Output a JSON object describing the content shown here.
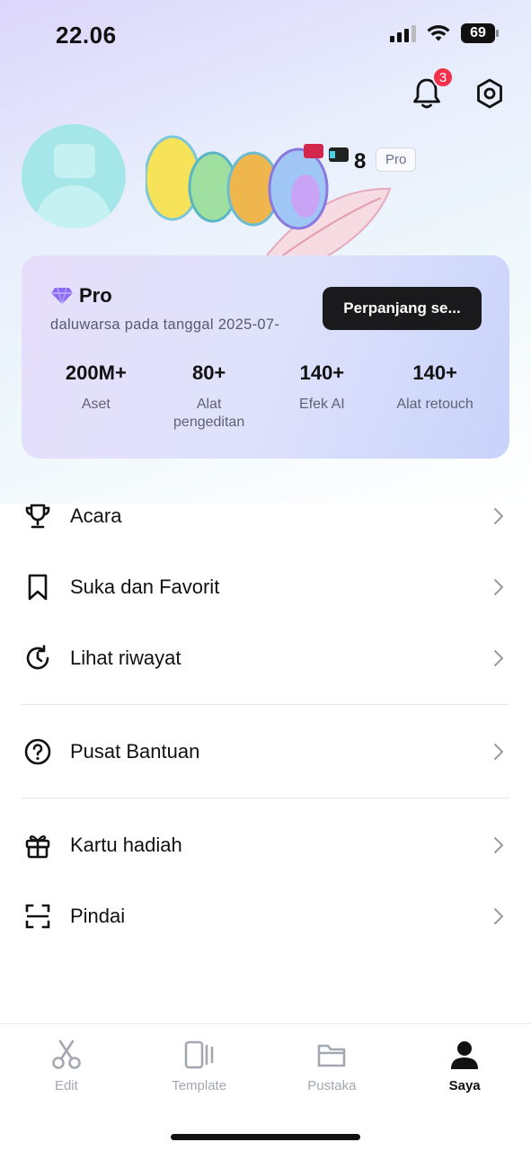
{
  "status_bar": {
    "time": "22.06",
    "battery": "69"
  },
  "header": {
    "notification_count": "3",
    "icons": [
      "bell-icon",
      "settings-hex-icon"
    ]
  },
  "profile": {
    "username_suffix": "8",
    "badge": "Pro",
    "id_prefix": "L"
  },
  "pro_card": {
    "title": "Pro",
    "expiry": "daluwarsa pada tanggal 2025-07-",
    "renew_label": "Perpanjang se...",
    "stats": [
      {
        "value": "200M+",
        "label": "Aset"
      },
      {
        "value": "80+",
        "label": "Alat pengeditan"
      },
      {
        "value": "140+",
        "label": "Efek AI"
      },
      {
        "value": "140+",
        "label": "Alat retouch"
      }
    ]
  },
  "menu": {
    "group1": [
      {
        "label": "Acara",
        "icon": "trophy-icon"
      },
      {
        "label": "Suka dan Favorit",
        "icon": "bookmark-icon"
      },
      {
        "label": "Lihat riwayat",
        "icon": "history-icon"
      }
    ],
    "group2": [
      {
        "label": "Pusat Bantuan",
        "icon": "help-circle-icon"
      }
    ],
    "group3": [
      {
        "label": "Kartu hadiah",
        "icon": "gift-icon"
      },
      {
        "label": "Pindai",
        "icon": "scan-icon"
      }
    ]
  },
  "tabbar": {
    "tabs": [
      {
        "label": "Edit",
        "icon": "scissors-icon"
      },
      {
        "label": "Template",
        "icon": "template-icon"
      },
      {
        "label": "Pustaka",
        "icon": "folder-icon"
      },
      {
        "label": "Saya",
        "icon": "person-icon"
      }
    ],
    "active": "Saya"
  },
  "colors": {
    "badge_red": "#f2304a",
    "accent_purple": "#8b6cf2",
    "dark_button": "#1a1a1c"
  }
}
